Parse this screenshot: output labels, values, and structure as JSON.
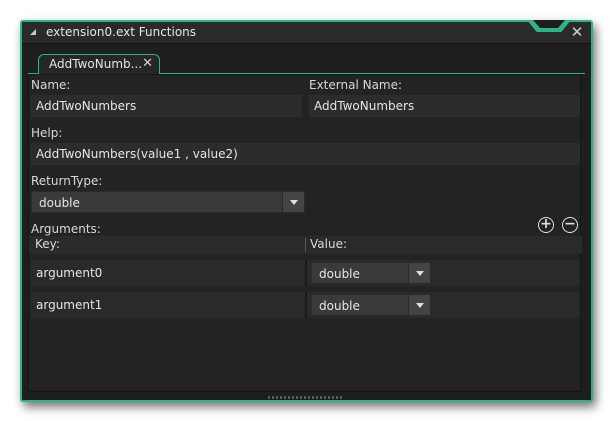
{
  "window": {
    "title": "extension0.ext Functions",
    "close_glyph": "✕"
  },
  "tab": {
    "label": "AddTwoNumb...",
    "close_glyph": "✕"
  },
  "form": {
    "name_label": "Name:",
    "name_value": "AddTwoNumbers",
    "external_name_label": "External Name:",
    "external_name_value": "AddTwoNumbers",
    "help_label": "Help:",
    "help_value": "AddTwoNumbers(value1 , value2)",
    "return_type_label": "ReturnType:",
    "return_type_value": "double",
    "arguments_label": "Arguments:",
    "add_glyph": "+",
    "remove_glyph": "−"
  },
  "arguments_table": {
    "columns": [
      "Key:",
      "Value:"
    ],
    "rows": [
      {
        "key": "argument0",
        "value": "double"
      },
      {
        "key": "argument1",
        "value": "double"
      }
    ]
  },
  "colors": {
    "accent": "#2bb389",
    "background": "#1e1e1e"
  }
}
